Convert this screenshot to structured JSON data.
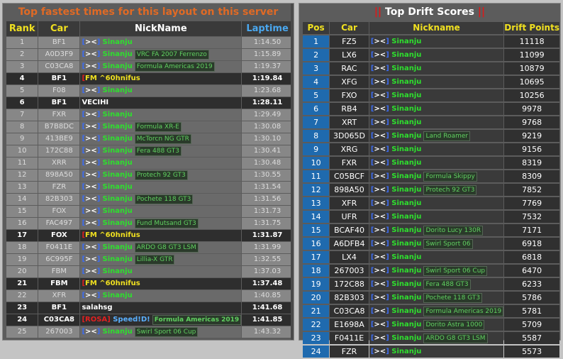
{
  "left": {
    "title": "Top fastest times for this layout on this server",
    "headers": {
      "rank": "Rank",
      "car": "Car",
      "nick": "NickName",
      "lap": "Laptime"
    },
    "rows": [
      {
        "rank": "1",
        "car": "BF1",
        "nick": "[><] Sinanju",
        "carname": "",
        "lap": "1:14.50",
        "style": "lt"
      },
      {
        "rank": "2",
        "car": "A0D3F9",
        "nick": "[><] Sinanju",
        "carname": "VRC FA 2007 Ferrenzo",
        "lap": "1:15.89",
        "style": "lt"
      },
      {
        "rank": "3",
        "car": "C03CA8",
        "nick": "[><] Sinanju",
        "carname": "Formula Americas 2019",
        "lap": "1:19.37",
        "style": "lt"
      },
      {
        "rank": "4",
        "car": "BF1",
        "nick": "[FM ^60hnifus",
        "carname": "",
        "lap": "1:19.84",
        "style": "hl"
      },
      {
        "rank": "5",
        "car": "F08",
        "nick": "[><] Sinanju",
        "carname": "",
        "lap": "1:23.68",
        "style": "lt"
      },
      {
        "rank": "6",
        "car": "BF1",
        "nick": "VECIHI",
        "carname": "",
        "lap": "1:28.11",
        "style": "hl"
      },
      {
        "rank": "7",
        "car": "FXR",
        "nick": "[><] Sinanju",
        "carname": "",
        "lap": "1:29.49",
        "style": "lt"
      },
      {
        "rank": "8",
        "car": "B7B8DC",
        "nick": "[><] Sinanju",
        "carname": "Formula XR-E",
        "lap": "1:30.08",
        "style": "lt"
      },
      {
        "rank": "9",
        "car": "413BE9",
        "nick": "[><] Sinanju",
        "carname": "McTorcn NG GTR",
        "lap": "1:30.10",
        "style": "lt"
      },
      {
        "rank": "10",
        "car": "172C88",
        "nick": "[><] Sinanju",
        "carname": "Fera 488 GT3",
        "lap": "1:30.41",
        "style": "lt"
      },
      {
        "rank": "11",
        "car": "XRR",
        "nick": "[><] Sinanju",
        "carname": "",
        "lap": "1:30.48",
        "style": "lt"
      },
      {
        "rank": "12",
        "car": "898A50",
        "nick": "[><] Sinanju",
        "carname": "Protech 92 GT3",
        "lap": "1:30.55",
        "style": "lt"
      },
      {
        "rank": "13",
        "car": "FZR",
        "nick": "[><] Sinanju",
        "carname": "",
        "lap": "1:31.54",
        "style": "lt"
      },
      {
        "rank": "14",
        "car": "82B303",
        "nick": "[><] Sinanju",
        "carname": "Pochete 118 GT3",
        "lap": "1:31.56",
        "style": "lt"
      },
      {
        "rank": "15",
        "car": "FOX",
        "nick": "[><] Sinanju",
        "carname": "",
        "lap": "1:31.73",
        "style": "lt"
      },
      {
        "rank": "16",
        "car": "FAC497",
        "nick": "[><] Sinanju",
        "carname": "Fund Mutsand GT3",
        "lap": "1:31.75",
        "style": "lt"
      },
      {
        "rank": "17",
        "car": "FOX",
        "nick": "[FM ^60hnifus",
        "carname": "",
        "lap": "1:31.87",
        "style": "hl"
      },
      {
        "rank": "18",
        "car": "F0411E",
        "nick": "[><] Sinanju",
        "carname": "ARDO G8 GT3 LSM",
        "lap": "1:31.99",
        "style": "lt"
      },
      {
        "rank": "19",
        "car": "6C995F",
        "nick": "[><] Sinanju",
        "carname": "Lillia-X GTR",
        "lap": "1:32.55",
        "style": "lt"
      },
      {
        "rank": "20",
        "car": "FBM",
        "nick": "[><] Sinanju",
        "carname": "",
        "lap": "1:37.03",
        "style": "lt"
      },
      {
        "rank": "21",
        "car": "FBM",
        "nick": "[FM ^60hnifus",
        "carname": "",
        "lap": "1:37.48",
        "style": "hl"
      },
      {
        "rank": "22",
        "car": "XFR",
        "nick": "[><] Sinanju",
        "carname": "",
        "lap": "1:40.85",
        "style": "lt"
      },
      {
        "rank": "23",
        "car": "BF1",
        "nick": "salahsg",
        "carname": "",
        "lap": "1:41.68",
        "style": "hl"
      },
      {
        "rank": "24",
        "car": "C03CA8",
        "nick": "[ROSA] Speed!D!",
        "carname": "Formula Americas 2019",
        "lap": "1:41.85",
        "style": "hl"
      },
      {
        "rank": "25",
        "car": "267003",
        "nick": "[><] Sinanju",
        "carname": "Swirl Sport 06 Cup",
        "lap": "1:43.32",
        "style": "lt"
      }
    ]
  },
  "right": {
    "title": "Top Drift Scores",
    "bars": "||",
    "headers": {
      "pos": "Pos",
      "car": "Car",
      "nick": "Nickname",
      "pts": "Drift Points"
    },
    "rows": [
      {
        "pos": "1",
        "car": "FZ5",
        "carname": "",
        "pts": "11118"
      },
      {
        "pos": "2",
        "car": "LX6",
        "carname": "",
        "pts": "11099"
      },
      {
        "pos": "3",
        "car": "RAC",
        "carname": "",
        "pts": "10879"
      },
      {
        "pos": "4",
        "car": "XFG",
        "carname": "",
        "pts": "10695"
      },
      {
        "pos": "5",
        "car": "FXO",
        "carname": "",
        "pts": "10256"
      },
      {
        "pos": "6",
        "car": "RB4",
        "carname": "",
        "pts": "9978"
      },
      {
        "pos": "7",
        "car": "XRT",
        "carname": "",
        "pts": "9768"
      },
      {
        "pos": "8",
        "car": "3D065D",
        "carname": "Land Roamer",
        "pts": "9219"
      },
      {
        "pos": "9",
        "car": "XRG",
        "carname": "",
        "pts": "9156"
      },
      {
        "pos": "10",
        "car": "FXR",
        "carname": "",
        "pts": "8319"
      },
      {
        "pos": "11",
        "car": "C05BCF",
        "carname": "Formula Skippy",
        "pts": "8309"
      },
      {
        "pos": "12",
        "car": "898A50",
        "carname": "Protech 92 GT3",
        "pts": "7852"
      },
      {
        "pos": "13",
        "car": "XFR",
        "carname": "",
        "pts": "7769"
      },
      {
        "pos": "14",
        "car": "UFR",
        "carname": "",
        "pts": "7532"
      },
      {
        "pos": "15",
        "car": "BCAF40",
        "carname": "Dorito Lucy 130R",
        "pts": "7171"
      },
      {
        "pos": "16",
        "car": "A6DFB4",
        "carname": "Swirl Sport 06",
        "pts": "6918"
      },
      {
        "pos": "17",
        "car": "LX4",
        "carname": "",
        "pts": "6818"
      },
      {
        "pos": "18",
        "car": "267003",
        "carname": "Swirl Sport 06 Cup",
        "pts": "6470"
      },
      {
        "pos": "19",
        "car": "172C88",
        "carname": "Fera 488 GT3",
        "pts": "6233"
      },
      {
        "pos": "20",
        "car": "82B303",
        "carname": "Pochete 118 GT3",
        "pts": "5786"
      },
      {
        "pos": "21",
        "car": "C03CA8",
        "carname": "Formula Americas 2019",
        "pts": "5781"
      },
      {
        "pos": "22",
        "car": "E1698A",
        "carname": "Dorito Astra 1000",
        "pts": "5709"
      },
      {
        "pos": "23",
        "car": "F0411E",
        "carname": "ARDO G8 GT3 LSM",
        "pts": "5587"
      },
      {
        "pos": "24",
        "car": "FZR",
        "carname": "",
        "pts": "5573"
      }
    ],
    "nick": "[><] Sinanju"
  }
}
